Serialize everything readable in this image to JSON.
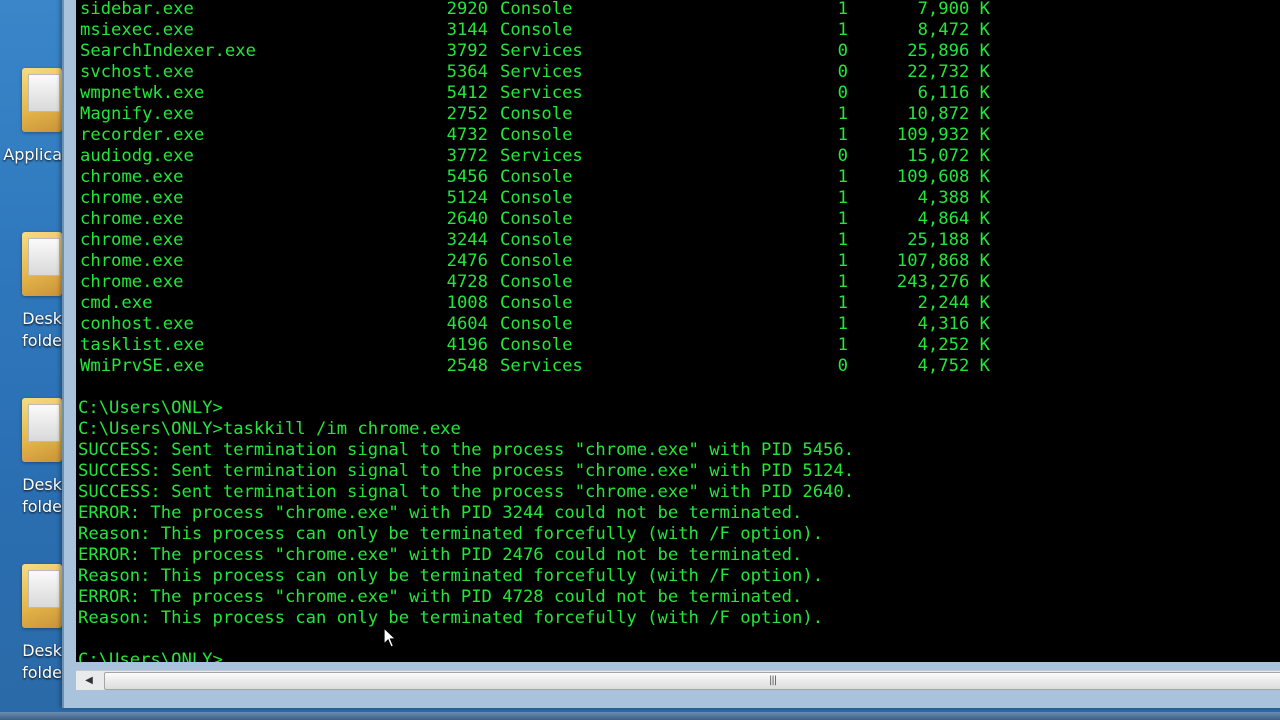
{
  "desktop_icons": [
    {
      "label": "Applica",
      "icon": "applications-folder-icon"
    },
    {
      "label": "Desk\nfolde",
      "icon": "folder-icon"
    },
    {
      "label": "Desk\nfolde",
      "icon": "folder-icon"
    },
    {
      "label": "Desk\nfolde",
      "icon": "folder-icon"
    }
  ],
  "tasklist": [
    {
      "name": "sidebar.exe",
      "pid": "2920",
      "session": "Console",
      "num": "1",
      "mem": "7,900 K"
    },
    {
      "name": "msiexec.exe",
      "pid": "3144",
      "session": "Console",
      "num": "1",
      "mem": "8,472 K"
    },
    {
      "name": "SearchIndexer.exe",
      "pid": "3792",
      "session": "Services",
      "num": "0",
      "mem": "25,896 K"
    },
    {
      "name": "svchost.exe",
      "pid": "5364",
      "session": "Services",
      "num": "0",
      "mem": "22,732 K"
    },
    {
      "name": "wmpnetwk.exe",
      "pid": "5412",
      "session": "Services",
      "num": "0",
      "mem": "6,116 K"
    },
    {
      "name": "Magnify.exe",
      "pid": "2752",
      "session": "Console",
      "num": "1",
      "mem": "10,872 K"
    },
    {
      "name": "recorder.exe",
      "pid": "4732",
      "session": "Console",
      "num": "1",
      "mem": "109,932 K"
    },
    {
      "name": "audiodg.exe",
      "pid": "3772",
      "session": "Services",
      "num": "0",
      "mem": "15,072 K"
    },
    {
      "name": "chrome.exe",
      "pid": "5456",
      "session": "Console",
      "num": "1",
      "mem": "109,608 K"
    },
    {
      "name": "chrome.exe",
      "pid": "5124",
      "session": "Console",
      "num": "1",
      "mem": "4,388 K"
    },
    {
      "name": "chrome.exe",
      "pid": "2640",
      "session": "Console",
      "num": "1",
      "mem": "4,864 K"
    },
    {
      "name": "chrome.exe",
      "pid": "3244",
      "session": "Console",
      "num": "1",
      "mem": "25,188 K"
    },
    {
      "name": "chrome.exe",
      "pid": "2476",
      "session": "Console",
      "num": "1",
      "mem": "107,868 K"
    },
    {
      "name": "chrome.exe",
      "pid": "4728",
      "session": "Console",
      "num": "1",
      "mem": "243,276 K"
    },
    {
      "name": "cmd.exe",
      "pid": "1008",
      "session": "Console",
      "num": "1",
      "mem": "2,244 K"
    },
    {
      "name": "conhost.exe",
      "pid": "4604",
      "session": "Console",
      "num": "1",
      "mem": "4,316 K"
    },
    {
      "name": "tasklist.exe",
      "pid": "4196",
      "session": "Console",
      "num": "1",
      "mem": "4,252 K"
    },
    {
      "name": "WmiPrvSE.exe",
      "pid": "2548",
      "session": "Services",
      "num": "0",
      "mem": "4,752 K"
    }
  ],
  "output_lines": [
    "",
    "C:\\Users\\ONLY>",
    "C:\\Users\\ONLY>taskkill /im chrome.exe",
    "SUCCESS: Sent termination signal to the process \"chrome.exe\" with PID 5456.",
    "SUCCESS: Sent termination signal to the process \"chrome.exe\" with PID 5124.",
    "SUCCESS: Sent termination signal to the process \"chrome.exe\" with PID 2640.",
    "ERROR: The process \"chrome.exe\" with PID 3244 could not be terminated.",
    "Reason: This process can only be terminated forcefully (with /F option).",
    "ERROR: The process \"chrome.exe\" with PID 2476 could not be terminated.",
    "Reason: This process can only be terminated forcefully (with /F option).",
    "ERROR: The process \"chrome.exe\" with PID 4728 could not be terminated.",
    "Reason: This process can only be terminated forcefully (with /F option).",
    "",
    "C:\\Users\\ONLY>"
  ],
  "scrollbar": {
    "grip": "|||"
  },
  "colors": {
    "console_text": "#22e73a",
    "console_bg": "#000000"
  }
}
